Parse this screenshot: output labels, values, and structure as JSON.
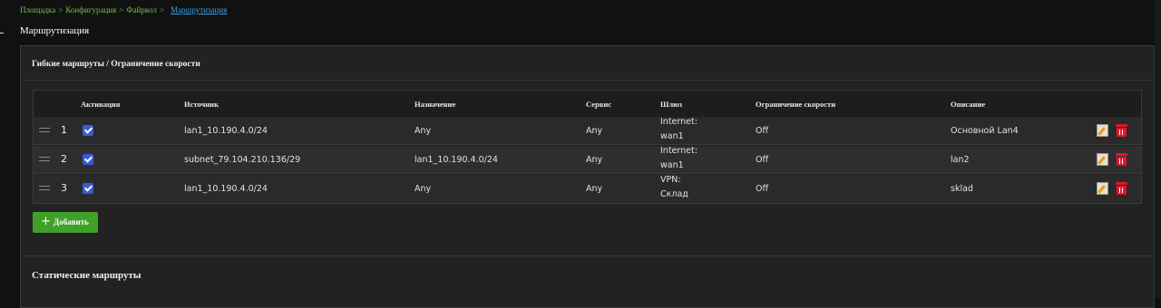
{
  "breadcrumb": {
    "items": [
      "Площадка",
      "Конфигурация",
      "Файрвол"
    ],
    "separator": ">",
    "current": "Маршрутизация"
  },
  "page_title": "Маршрутизация",
  "panel": {
    "title": "Гибкие маршруты / Ограничение скорости",
    "columns": [
      "Активация",
      "Источник",
      "Назначение",
      "Сервис",
      "Шлюз",
      "Ограничение скорости",
      "Описание"
    ],
    "rows": [
      {
        "index": "1",
        "active": true,
        "source": "lan1_10.190.4.0/24",
        "destination": "Any",
        "service": "Any",
        "gateway_line1": "Internet:",
        "gateway_line2": "wan1",
        "speed_limit": "Off",
        "description": "Основной Lan4"
      },
      {
        "index": "2",
        "active": true,
        "source": "subnet_79.104.210.136/29",
        "destination": "lan1_10.190.4.0/24",
        "service": "Any",
        "gateway_line1": "Internet:",
        "gateway_line2": "wan1",
        "speed_limit": "Off",
        "description": "lan2"
      },
      {
        "index": "3",
        "active": true,
        "source": "lan1_10.190.4.0/24",
        "destination": "Any",
        "service": "Any",
        "gateway_line1": "VPN:",
        "gateway_line2": "Склад",
        "speed_limit": "Off",
        "description": "sklad"
      }
    ],
    "add_button": {
      "icon": "plus-icon",
      "label": "Добавить"
    }
  },
  "static_routes_title": "Статические маршруты",
  "colors": {
    "background": "#111111",
    "panel": "#222222",
    "accent_green": "#3fa12a",
    "link_blue": "#3aa0e0",
    "checkbox_blue": "#3a5bd8",
    "delete_red": "#e3162b"
  }
}
